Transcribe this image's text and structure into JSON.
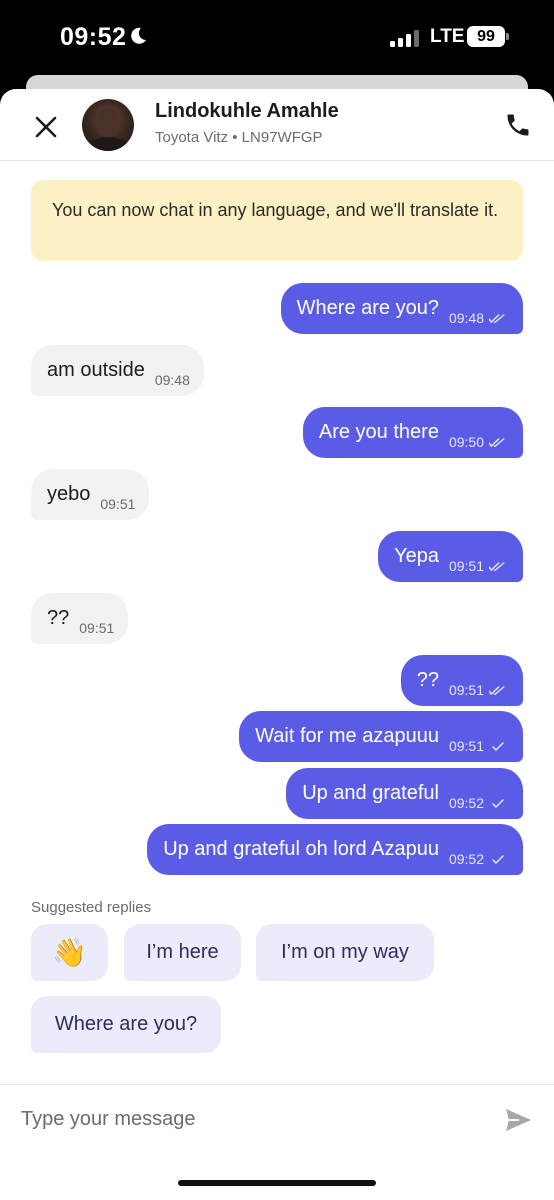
{
  "status_bar": {
    "time": "09:52",
    "network": "LTE",
    "battery": "99"
  },
  "header": {
    "name": "Lindokuhle Amahle",
    "vehicle": "Toyota Vitz • LN97WFGP",
    "close_icon": "close-icon",
    "call_icon": "phone-icon"
  },
  "banner": {
    "text": "You can now chat in any language, and we'll translate it."
  },
  "messages": [
    {
      "direction": "out",
      "text": "Where are you?",
      "time": "09:48",
      "status": "read"
    },
    {
      "direction": "in",
      "text": "am outside",
      "time": "09:48"
    },
    {
      "direction": "out",
      "text": "Are you there",
      "time": "09:50",
      "status": "read"
    },
    {
      "direction": "in",
      "text": "yebo",
      "time": "09:51"
    },
    {
      "direction": "out",
      "text": "Yepa",
      "time": "09:51",
      "status": "read"
    },
    {
      "direction": "in",
      "text": "??",
      "time": "09:51"
    },
    {
      "direction": "out",
      "text": "??",
      "time": "09:51",
      "status": "read"
    },
    {
      "direction": "out",
      "text": "Wait for me azapuuu",
      "time": "09:51",
      "status": "sent"
    },
    {
      "direction": "out",
      "text": "Up and grateful",
      "time": "09:52",
      "status": "sent"
    },
    {
      "direction": "out",
      "text": "Up and grateful oh lord Azapuu",
      "time": "09:52",
      "status": "sent"
    }
  ],
  "suggested": {
    "label": "Suggested replies",
    "chips": [
      "👋",
      "I’m here",
      "I’m on my way",
      "Where are you?"
    ]
  },
  "composer": {
    "placeholder": "Type your message",
    "send_icon": "send-icon"
  },
  "colors": {
    "accent": "#5b5ce6",
    "banner": "#fbf1c4",
    "incoming": "#f2f2f4",
    "chip": "#ebebfb"
  }
}
